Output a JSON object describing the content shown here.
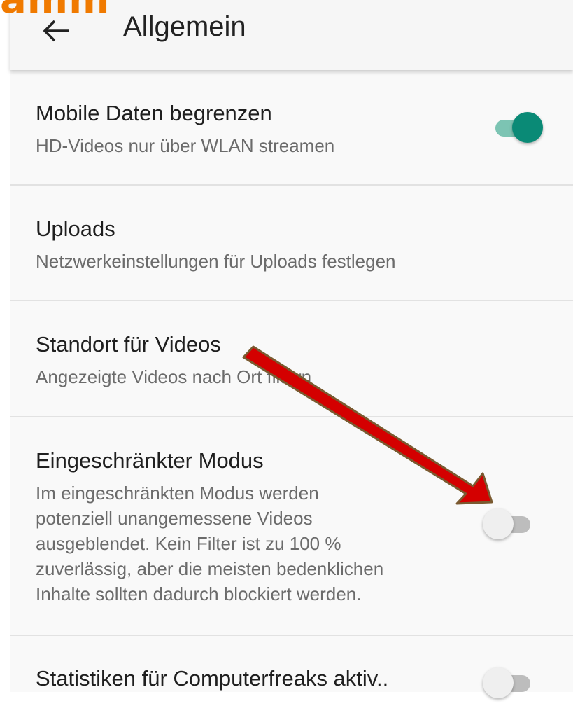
{
  "watermark": "amm",
  "header": {
    "title": "Allgemein",
    "back_icon": "arrow-back-icon"
  },
  "settings": [
    {
      "title": "Mobile Daten begrenzen",
      "subtitle_lines": [
        "HD-Videos nur über WLAN streamen"
      ],
      "toggle": "on"
    },
    {
      "title": "Uploads",
      "subtitle_lines": [
        "Netzwerkeinstellungen für Uploads festlegen"
      ]
    },
    {
      "title": "Standort für Videos",
      "subtitle_lines": [
        "Angezeigte Videos nach Ort filtern"
      ]
    },
    {
      "title": "Eingeschränkter Modus",
      "subtitle_lines": [
        "Im eingeschränkten Modus werden",
        "potenziell unangemessene Videos",
        "ausgeblendet. Kein Filter ist zu 100 %",
        "zuverlässig, aber die meisten bedenklichen",
        "Inhalte sollten dadurch blockiert werden."
      ],
      "toggle": "off"
    },
    {
      "title": "Statistiken für Computerfreaks aktiv..",
      "toggle": "off"
    }
  ],
  "colors": {
    "toggle_on": "#0a8a76",
    "toggle_track_on": "#7cc4b3",
    "annotation_arrow": "#d40000",
    "watermark": "#f07a00"
  }
}
